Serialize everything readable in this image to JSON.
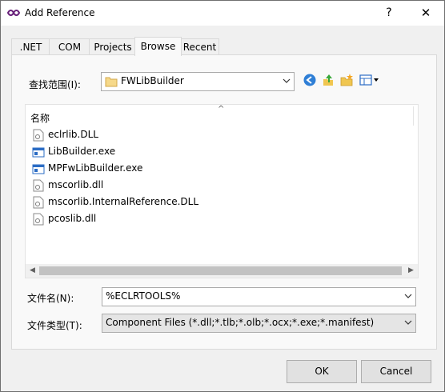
{
  "window": {
    "title": "Add Reference",
    "help_label": "?",
    "close_label": "✕"
  },
  "tabs": [
    {
      "label": ".NET"
    },
    {
      "label": "COM"
    },
    {
      "label": "Projects"
    },
    {
      "label": "Browse",
      "active": true
    },
    {
      "label": "Recent"
    }
  ],
  "lookin": {
    "label": "查找范围(I):",
    "value": "FWLibBuilder"
  },
  "file_list": {
    "column_name": "名称",
    "items": [
      {
        "name": "eclrlib.DLL",
        "icon": "dll-file-icon"
      },
      {
        "name": "LibBuilder.exe",
        "icon": "exe-file-icon"
      },
      {
        "name": "MPFwLibBuilder.exe",
        "icon": "exe-file-icon"
      },
      {
        "name": "mscorlib.dll",
        "icon": "dll-file-icon"
      },
      {
        "name": "mscorlib.InternalReference.DLL",
        "icon": "dll-file-icon"
      },
      {
        "name": "pcoslib.dll",
        "icon": "dll-file-icon"
      }
    ]
  },
  "filename": {
    "label": "文件名(N):",
    "value": "%ECLRTOOLS%"
  },
  "filetype": {
    "label": "文件类型(T):",
    "value": "Component Files (*.dll;*.tlb;*.olb;*.ocx;*.exe;*.manifest)"
  },
  "buttons": {
    "ok": "OK",
    "cancel": "Cancel"
  },
  "colors": {
    "accent": "#0078d7",
    "folder": "#e8c36a",
    "window_bg": "#f0f0f0"
  }
}
